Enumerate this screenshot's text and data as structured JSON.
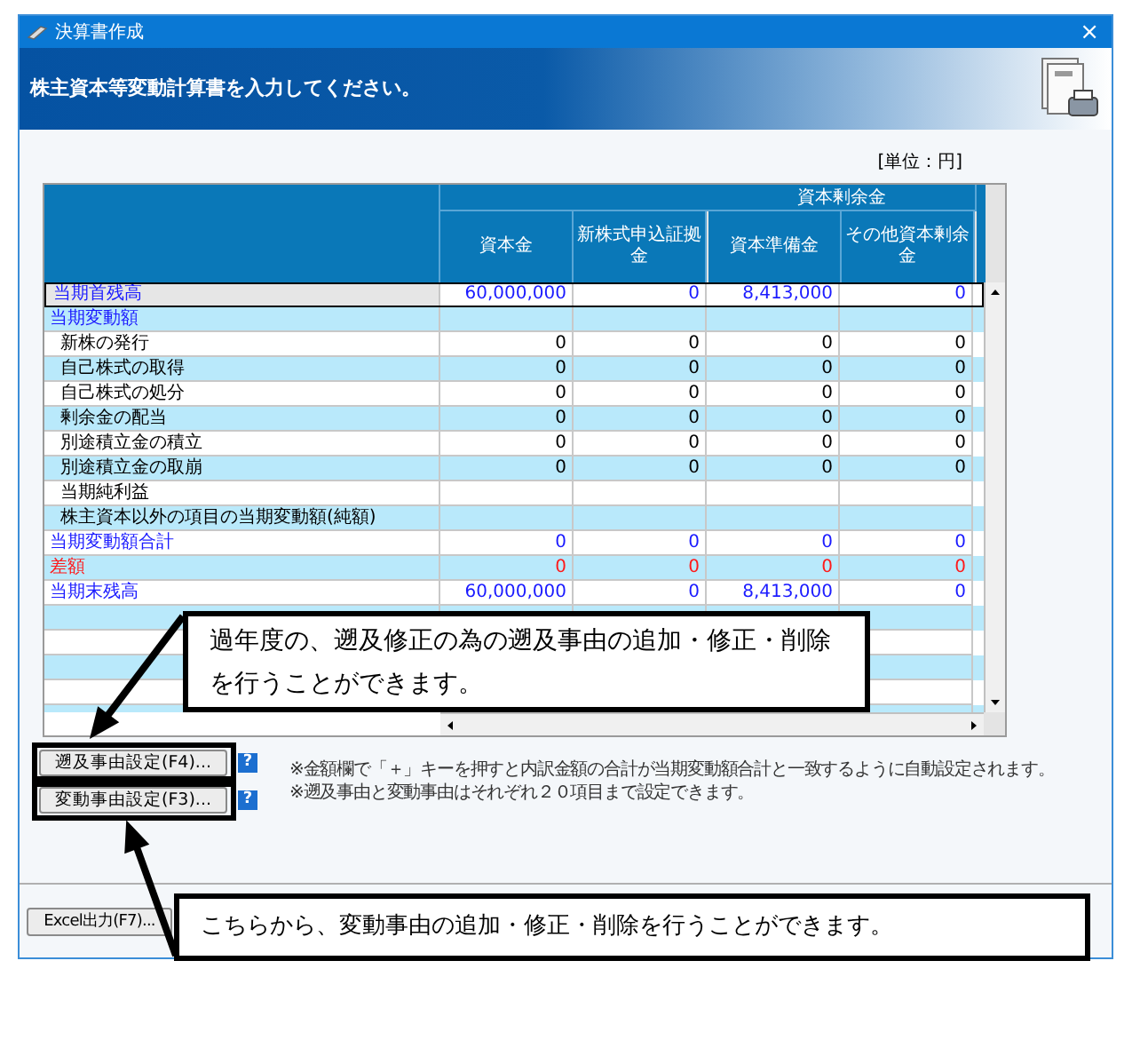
{
  "window": {
    "title": "決算書作成",
    "close": "×"
  },
  "banner": {
    "instruction": "株主資本等変動計算書を入力してください。"
  },
  "unit": "[単位：円]",
  "table": {
    "group_header": "資本剰余金",
    "columns": [
      "資本金",
      "新株式申込証拠金",
      "資本準備金",
      "その他資本剰余金"
    ],
    "rows": [
      {
        "label": "当期首残高",
        "kind": "total",
        "selected": true,
        "values": [
          "60,000,000",
          "0",
          "8,413,000",
          "0"
        ]
      },
      {
        "label": "当期変動額",
        "kind": "section",
        "selected": false
      },
      {
        "label": "新株の発行",
        "kind": "item",
        "selected": false,
        "values": [
          "0",
          "0",
          "0",
          "0"
        ]
      },
      {
        "label": "自己株式の取得",
        "kind": "item",
        "selected": false,
        "values": [
          "0",
          "0",
          "0",
          "0"
        ]
      },
      {
        "label": "自己株式の処分",
        "kind": "item",
        "selected": false,
        "values": [
          "0",
          "0",
          "0",
          "0"
        ]
      },
      {
        "label": "剰余金の配当",
        "kind": "item",
        "selected": false,
        "values": [
          "0",
          "0",
          "0",
          "0"
        ]
      },
      {
        "label": "別途積立金の積立",
        "kind": "item",
        "selected": false,
        "values": [
          "0",
          "0",
          "0",
          "0"
        ]
      },
      {
        "label": "別途積立金の取崩",
        "kind": "item",
        "selected": false,
        "values": [
          "0",
          "0",
          "0",
          "0"
        ]
      },
      {
        "label": "当期純利益",
        "kind": "item",
        "selected": false
      },
      {
        "label": "株主資本以外の項目の当期変動額(純額)",
        "kind": "item",
        "selected": false
      },
      {
        "label": "当期変動額合計",
        "kind": "total",
        "selected": false,
        "values": [
          "0",
          "0",
          "0",
          "0"
        ]
      },
      {
        "label": "差額",
        "kind": "diff",
        "selected": false,
        "values": [
          "0",
          "0",
          "0",
          "0"
        ]
      },
      {
        "label": "当期末残高",
        "kind": "total",
        "selected": false,
        "values": [
          "60,000,000",
          "0",
          "8,413,000",
          "0"
        ]
      }
    ]
  },
  "buttons": [
    {
      "label": "遡及事由設定(F4)...",
      "help": "?"
    },
    {
      "label": "変動事由設定(F3)...",
      "help": "?"
    }
  ],
  "notes": [
    "※金額欄で「＋」キーを押すと内訳金額の合計が当期変動額合計と一致するように自動設定されます。",
    "※遡及事由と変動事由はそれぞれ２０項目まで設定できます。"
  ],
  "excel_button": "Excel出力(F7)...",
  "callouts": [
    {
      "text": "過年度の、遡及修正の為の遡及事由の追加・修正・削除を行うことができます。"
    },
    {
      "text": "こちらから、変動事由の追加・修正・削除を行うことができます。"
    }
  ]
}
